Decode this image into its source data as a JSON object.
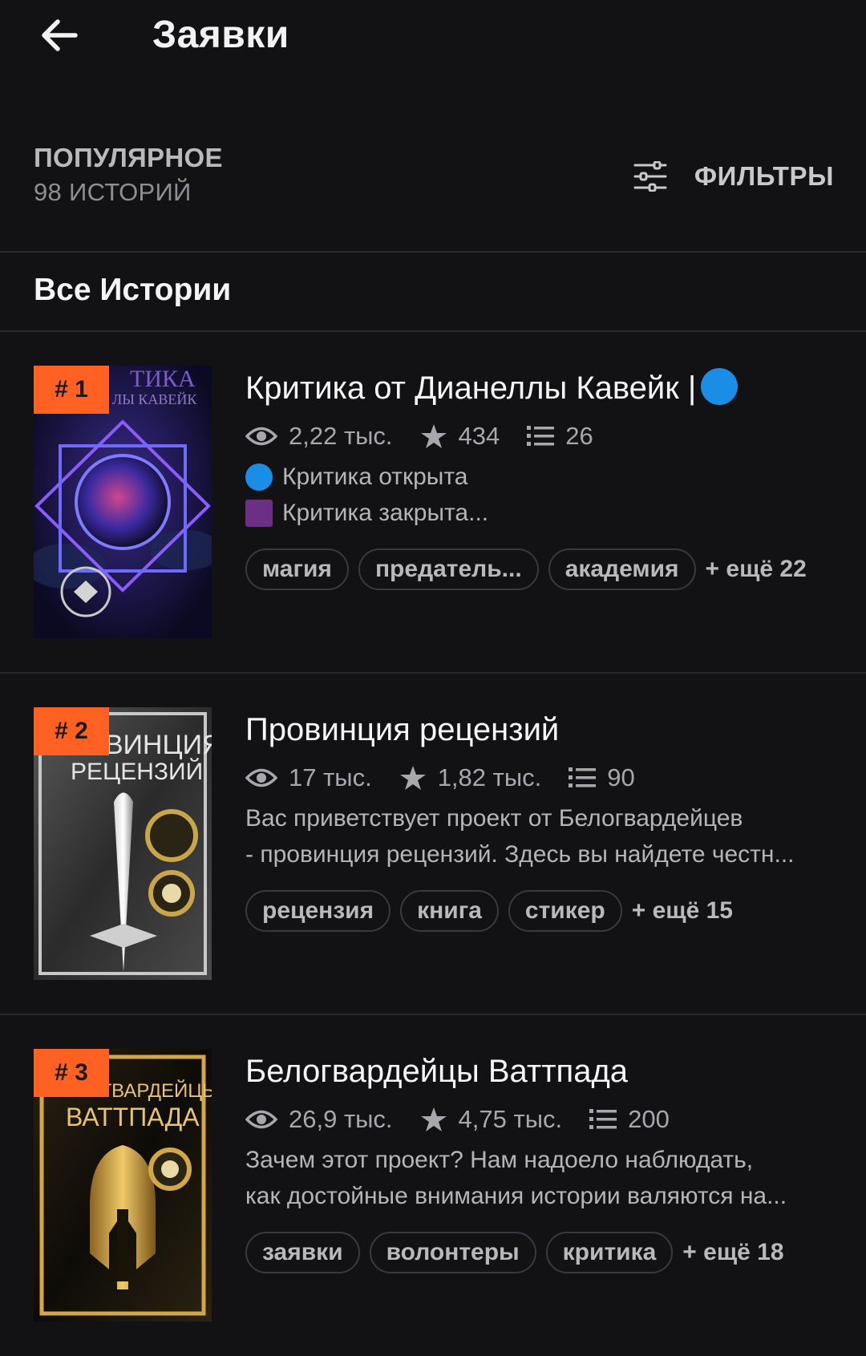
{
  "header": {
    "title": "Заявки",
    "back_icon": "arrow-left-icon"
  },
  "sort": {
    "name": "ПОПУЛЯРНОЕ",
    "count": "98 ИСТОРИЙ",
    "filters_label": "ФИЛЬТРЫ"
  },
  "section": {
    "title": "Все Истории"
  },
  "colors": {
    "accent": "#ff6122",
    "background": "#121215",
    "blue_dot": "#1a8ee6",
    "purple_square": "#6b2f86"
  },
  "stories": [
    {
      "rank": "# 1",
      "cover_text": [
        "ТИКА",
        "ЛЫ КАВЕЙК"
      ],
      "title": "Критика от Дианеллы Кавейк  |",
      "views": "2,22 тыс.",
      "votes": "434",
      "parts": "26",
      "desc": [
        "Критика открыта",
        "Критика закрыта..."
      ],
      "tags": [
        "магия",
        "предатель...",
        "академия"
      ],
      "more": "+ ещё 22"
    },
    {
      "rank": "# 2",
      "cover_text": [
        "ПРОВИНЦИЯ",
        "РЕЦЕНЗИЙ"
      ],
      "title": "Провинция рецензий",
      "views": "17 тыс.",
      "votes": "1,82 тыс.",
      "parts": "90",
      "desc": [
        "Вас приветствует проект от Белогвардейцев",
        "- провинция рецензий. Здесь вы найдете честн..."
      ],
      "tags": [
        "рецензия",
        "книга",
        "стикер"
      ],
      "more": "+ ещё 15"
    },
    {
      "rank": "# 3",
      "cover_text": [
        "БЕЛОГВАРДЕЙЦЫ",
        "ВАТТПАДА"
      ],
      "title": "Белогвардейцы Ваттпада",
      "views": "26,9 тыс.",
      "votes": "4,75 тыс.",
      "parts": "200",
      "desc": [
        "Зачем этот проект? Нам надоело наблюдать,",
        "как достойные внимания истории валяются на..."
      ],
      "tags": [
        "заявки",
        "волонтеры",
        "критика"
      ],
      "more": "+ ещё 18"
    }
  ]
}
